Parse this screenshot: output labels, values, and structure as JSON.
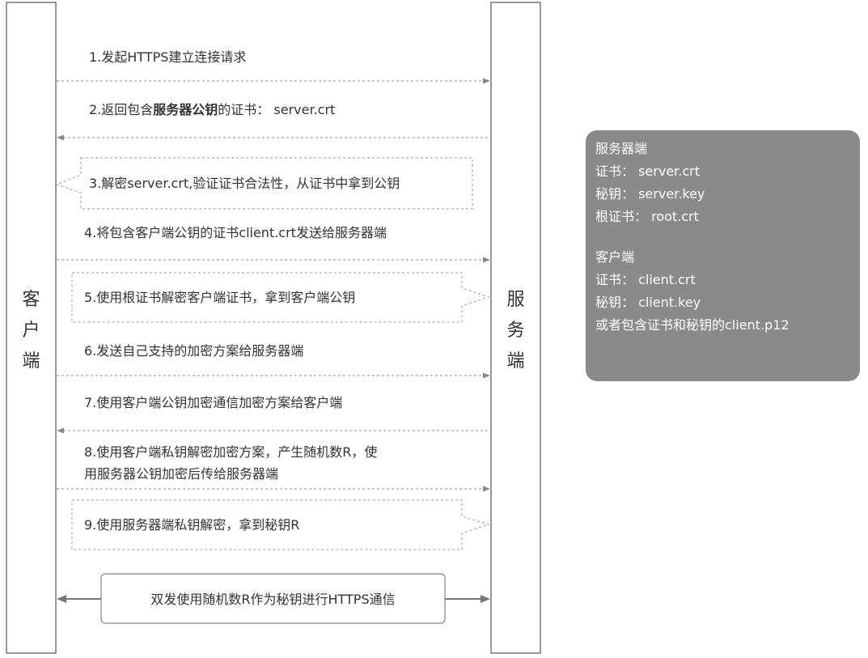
{
  "actors": {
    "client": "客户端",
    "server": "服务端"
  },
  "messages": [
    {
      "id": "1",
      "direction": "to-server",
      "kind": "arrow",
      "parts": [
        {
          "text": "1.发起HTTPS建立连接请求",
          "bold": false
        }
      ]
    },
    {
      "id": "2",
      "direction": "to-client",
      "kind": "arrow",
      "parts": [
        {
          "text": "2.返回包含",
          "bold": false
        },
        {
          "text": "服务器公钥",
          "bold": true
        },
        {
          "text": "的证书：  server.crt",
          "bold": false
        }
      ]
    },
    {
      "id": "3",
      "direction": "client-self",
      "kind": "note",
      "parts": [
        {
          "text": "3.解密server.crt,验证证书合法性，从证书中拿到公钥",
          "bold": false
        }
      ]
    },
    {
      "id": "4",
      "direction": "to-server",
      "kind": "arrow",
      "parts": [
        {
          "text": "4.将包含客户端公钥的证书client.crt发送给服务器端",
          "bold": false
        }
      ]
    },
    {
      "id": "5",
      "direction": "server-self",
      "kind": "note",
      "parts": [
        {
          "text": "5.使用根证书解密客户端证书，拿到客户端公钥",
          "bold": false
        }
      ]
    },
    {
      "id": "6",
      "direction": "to-server",
      "kind": "arrow",
      "parts": [
        {
          "text": "6.发送自己支持的加密方案给服务器端",
          "bold": false
        }
      ]
    },
    {
      "id": "7",
      "direction": "to-client",
      "kind": "arrow",
      "parts": [
        {
          "text": "7.使用客户端公钥加密通信加密方案给客户端",
          "bold": false
        }
      ]
    },
    {
      "id": "8",
      "direction": "to-server",
      "kind": "arrow",
      "lines": [
        "8.使用客户端私钥解密加密方案，产生随机数R，使",
        "用服务器公钥加密后传给服务器端"
      ]
    },
    {
      "id": "9",
      "direction": "server-self",
      "kind": "note",
      "parts": [
        {
          "text": "9.使用服务器端私钥解密，拿到秘钥R",
          "bold": false
        }
      ]
    }
  ],
  "final_exchange": "双发使用随机数R作为秘钥进行HTTPS通信",
  "info_panel": {
    "server_title": "服务器端",
    "server_lines": [
      "证书：  server.crt",
      "秘钥：  server.key",
      "根证书：  root.crt"
    ],
    "client_title": "客户端",
    "client_lines": [
      "证书：  client.crt",
      "秘钥：  client.key",
      "或者包含证书和秘钥的client.p12"
    ]
  },
  "colors": {
    "panel_background": "#8a8a8a",
    "panel_text": "#ffffff",
    "line": "#888888",
    "text": "#333333"
  }
}
